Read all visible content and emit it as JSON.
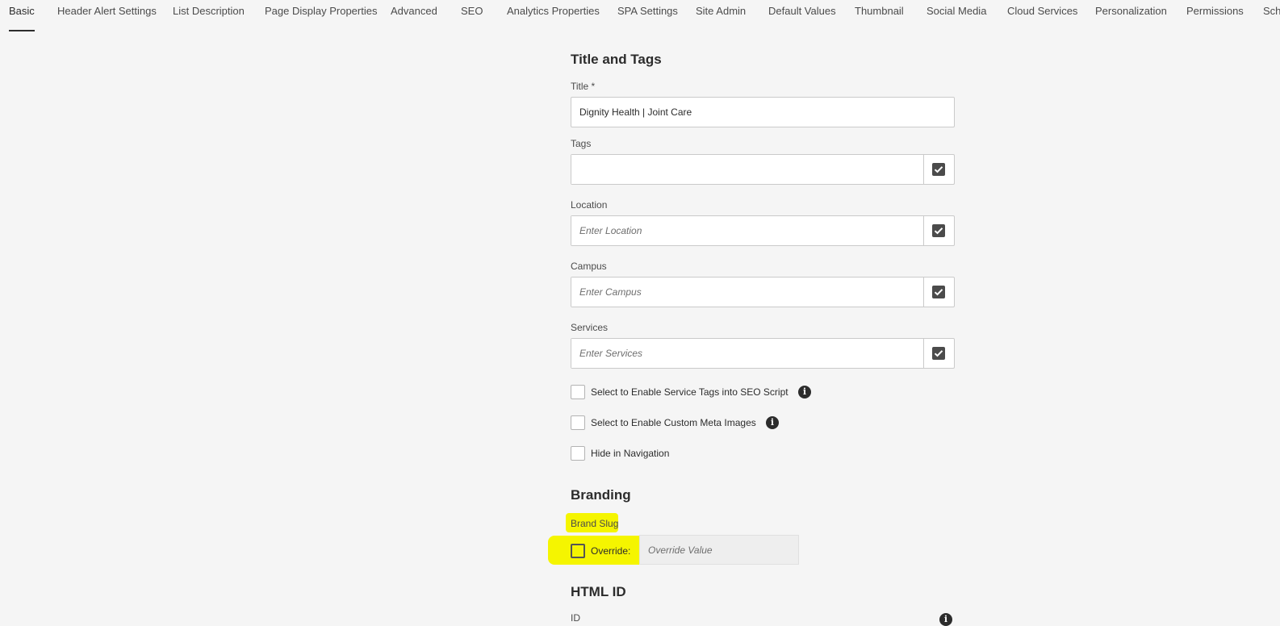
{
  "tabs": [
    {
      "label": "Basic",
      "active": true
    },
    {
      "label": "Header Alert Settings"
    },
    {
      "label": "List Description"
    },
    {
      "label": "Page Display Properties"
    },
    {
      "label": "Advanced"
    },
    {
      "label": "SEO"
    },
    {
      "label": "Analytics Properties"
    },
    {
      "label": "SPA Settings"
    },
    {
      "label": "Site Admin"
    },
    {
      "label": "Default Values"
    },
    {
      "label": "Thumbnail"
    },
    {
      "label": "Social Media"
    },
    {
      "label": "Cloud Services"
    },
    {
      "label": "Personalization"
    },
    {
      "label": "Permissions"
    },
    {
      "label": "Sche"
    }
  ],
  "title_tags": {
    "heading": "Title and Tags",
    "title_label": "Title *",
    "title_value": "Dignity Health | Joint Care",
    "tags_label": "Tags",
    "tags_value": "",
    "location_label": "Location",
    "location_placeholder": "Enter Location",
    "campus_label": "Campus",
    "campus_placeholder": "Enter Campus",
    "services_label": "Services",
    "services_placeholder": "Enter Services"
  },
  "checkboxes": {
    "service_tags_label": "Select to Enable Service Tags into SEO Script",
    "custom_meta_label": "Select to Enable Custom Meta Images",
    "hide_nav_label": "Hide in Navigation"
  },
  "branding": {
    "heading": "Branding",
    "brand_slug_label": "Brand Slug",
    "override_label": "Override:",
    "override_placeholder": "Override Value"
  },
  "html_id": {
    "heading": "HTML ID",
    "id_label": "ID"
  },
  "icons": {
    "picker": "checkbox-checked-icon",
    "info": "info-icon"
  },
  "colors": {
    "highlight": "#f5f500",
    "text": "#2c2c2c",
    "background": "#f5f5f5"
  }
}
